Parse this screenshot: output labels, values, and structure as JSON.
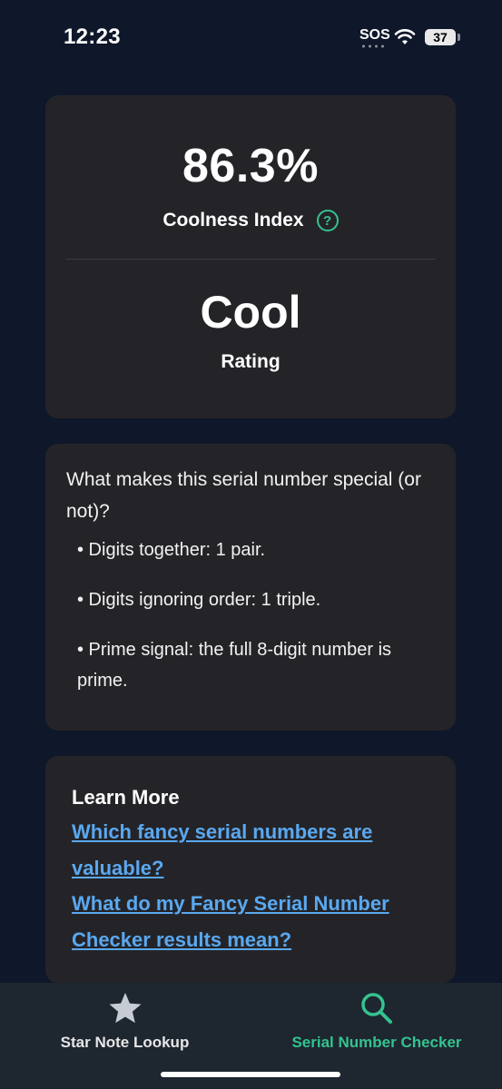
{
  "status_bar": {
    "time": "12:23",
    "sos": "SOS",
    "battery": "37"
  },
  "score_card": {
    "percent": "86.3%",
    "index_label": "Coolness Index",
    "help_symbol": "?",
    "rating_value": "Cool",
    "rating_label": "Rating"
  },
  "special_card": {
    "title": "What makes this serial number special (or not)?",
    "bullets": [
      "• Digits together: 1 pair.",
      "• Digits ignoring order: 1 triple.",
      "• Prime signal: the full 8-digit number is prime."
    ]
  },
  "learn_card": {
    "title": "Learn More",
    "links": [
      "Which fancy serial numbers are valuable?",
      "What do my Fancy Serial Number Checker results mean?"
    ]
  },
  "tabbar": {
    "tabs": [
      {
        "label": "Star Note Lookup",
        "icon": "star-icon",
        "active": false
      },
      {
        "label": "Serial Number Checker",
        "icon": "search-icon",
        "active": true
      }
    ]
  },
  "colors": {
    "background": "#0f172a",
    "card": "#242428",
    "accent_green": "#34c38f",
    "link_blue": "#5aa8f0",
    "tabbar": "#1e2630"
  }
}
